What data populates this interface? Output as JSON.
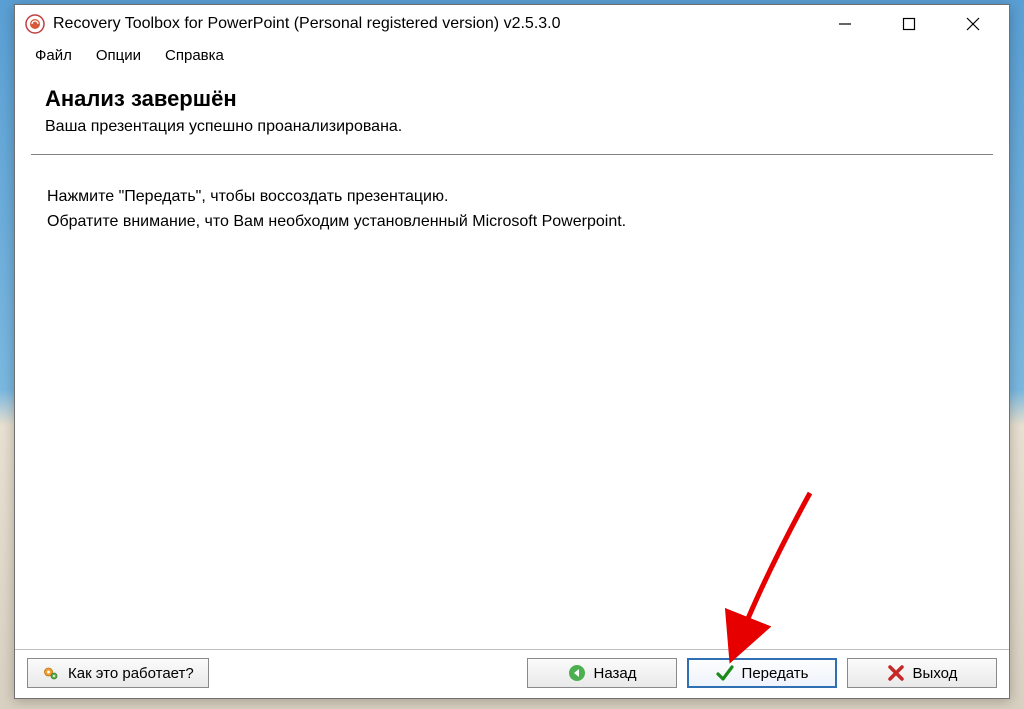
{
  "window": {
    "title": "Recovery Toolbox for PowerPoint (Personal registered version) v2.5.3.0"
  },
  "menu": {
    "file": "Файл",
    "options": "Опции",
    "help": "Справка"
  },
  "header": {
    "title": "Анализ завершён",
    "subtitle": "Ваша презентация успешно проанализирована."
  },
  "body": {
    "line1": "Нажмите \"Передать\", чтобы воссоздать презентацию.",
    "line2": "Обратите внимание, что Вам необходим установленный Microsoft Powerpoint."
  },
  "footer": {
    "how_it_works": "Как это работает?",
    "back": "Назад",
    "transfer": "Передать",
    "exit": "Выход"
  }
}
